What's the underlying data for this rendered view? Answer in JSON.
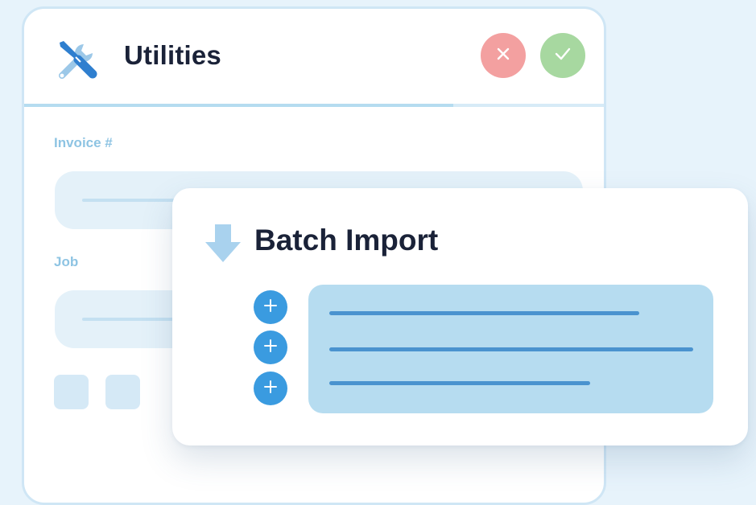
{
  "utilities_card": {
    "title": "Utilities",
    "icon": "tools-icon",
    "actions": {
      "cancel_icon": "close-icon",
      "confirm_icon": "check-icon"
    },
    "progress": 0.74,
    "fields": {
      "invoice_label": "Invoice #",
      "job_label": "Job"
    }
  },
  "batch_import_card": {
    "title": "Batch Import",
    "icon": "download-arrow-icon",
    "add_buttons_icon": "plus-icon"
  },
  "colors": {
    "background": "#e7f3fb",
    "title_text": "#1a2238",
    "field_label": "#8ec4e3",
    "cancel": "#f3a0a0",
    "confirm": "#a7d8a0",
    "accent_blue": "#3a9be0",
    "list_background": "#b6dcf0",
    "list_line": "#4a93cf"
  }
}
